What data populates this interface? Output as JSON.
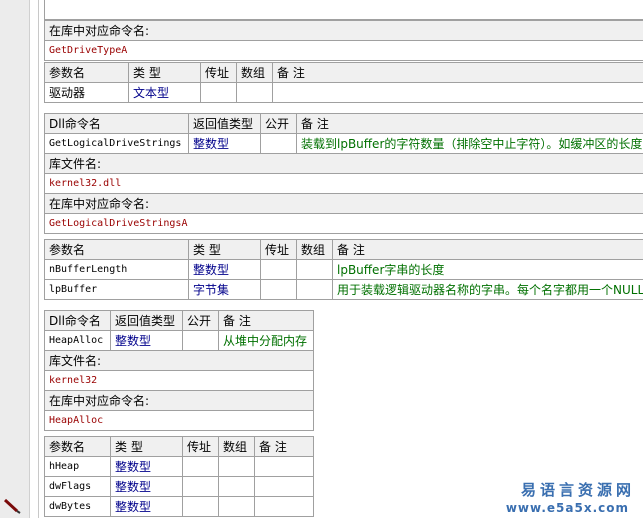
{
  "block1": {
    "alias_label": "在库中对应命令名:",
    "alias_value": "GetDriveTypeA",
    "param_headers": [
      "参数名",
      "类 型",
      "传址",
      "数组",
      "备 注"
    ],
    "params": [
      {
        "name": "驱动器",
        "type": "文本型",
        "byref": "",
        "array": "",
        "remark": ""
      }
    ]
  },
  "block2": {
    "headers": [
      "Dll命令名",
      "返回值类型",
      "公开",
      "备 注"
    ],
    "name": "GetLogicalDriveStrings",
    "ret_type": "整数型",
    "public": "",
    "remark": "装载到lpBuffer的字符数量（排除空中止字符）。如缓冲区的长度",
    "lib_label": "库文件名:",
    "lib_value": "kernel32.dll",
    "alias_label": "在库中对应命令名:",
    "alias_value": "GetLogicalDriveStringsA",
    "param_headers": [
      "参数名",
      "类 型",
      "传址",
      "数组",
      "备 注"
    ],
    "params": [
      {
        "name": "nBufferLength",
        "type": "整数型",
        "byref": "",
        "array": "",
        "remark": "lpBuffer字串的长度"
      },
      {
        "name": "lpBuffer",
        "type": "字节集",
        "byref": "",
        "array": "",
        "remark": "用于装载逻辑驱动器名称的字串。每个名字都用一个NULL字"
      }
    ]
  },
  "block3": {
    "headers": [
      "Dll命令名",
      "返回值类型",
      "公开",
      "备 注"
    ],
    "name": "HeapAlloc",
    "ret_type": "整数型",
    "public": "",
    "remark": "从堆中分配内存",
    "lib_label": "库文件名:",
    "lib_value": "kernel32",
    "alias_label": "在库中对应命令名:",
    "alias_value": "HeapAlloc",
    "param_headers": [
      "参数名",
      "类 型",
      "传址",
      "数组",
      "备 注"
    ],
    "params": [
      {
        "name": "hHeap",
        "type": "整数型",
        "byref": "",
        "array": "",
        "remark": ""
      },
      {
        "name": "dwFlags",
        "type": "整数型",
        "byref": "",
        "array": "",
        "remark": ""
      },
      {
        "name": "dwBytes",
        "type": "整数型",
        "byref": "",
        "array": "",
        "remark": ""
      }
    ]
  },
  "watermark": {
    "line1": "易语言资源网",
    "line2": "www.e5a5x.com"
  }
}
